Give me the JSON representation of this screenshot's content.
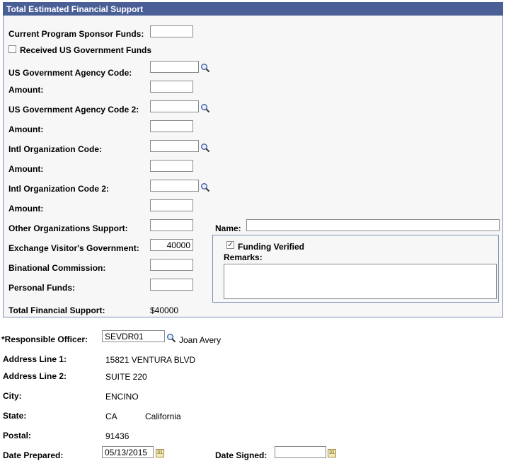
{
  "section_title": "Total Estimated Financial Support",
  "fields": {
    "current_program_sponsor_funds": {
      "label": "Current Program Sponsor Funds:",
      "value": ""
    },
    "received_us_gov_funds": {
      "label": "Received US Government Funds",
      "checked": false
    },
    "us_gov_agency_code": {
      "label": "US Government Agency Code:",
      "value": ""
    },
    "amount1": {
      "label": "Amount:",
      "value": ""
    },
    "us_gov_agency_code2": {
      "label": "US Government Agency Code 2:",
      "value": ""
    },
    "amount2": {
      "label": "Amount:",
      "value": ""
    },
    "intl_org_code": {
      "label": "Intl Organization Code:",
      "value": ""
    },
    "amount3": {
      "label": "Amount:",
      "value": ""
    },
    "intl_org_code2": {
      "label": "Intl Organization Code 2:",
      "value": ""
    },
    "amount4": {
      "label": "Amount:",
      "value": ""
    },
    "other_org_support": {
      "label": "Other Organizations Support:",
      "value": ""
    },
    "exchange_visitor_gov": {
      "label": "Exchange Visitor's Government:",
      "value": "40000"
    },
    "binational_commission": {
      "label": "Binational Commission:",
      "value": ""
    },
    "personal_funds": {
      "label": "Personal Funds:",
      "value": ""
    },
    "total_financial_support": {
      "label": "Total Financial Support:",
      "value": "$40000"
    },
    "name": {
      "label": "Name:",
      "value": ""
    },
    "funding_verified": {
      "label": "Funding Verified",
      "checked": true
    },
    "remarks": {
      "label": "Remarks:",
      "value": ""
    }
  },
  "officer": {
    "label": "*Responsible Officer:",
    "code": "SEVDR01",
    "name": "Joan Avery",
    "address1_label": "Address Line 1:",
    "address1": "15821 VENTURA BLVD",
    "address2_label": "Address Line 2:",
    "address2": "SUITE 220",
    "city_label": "City:",
    "city": "ENCINO",
    "state_label": "State:",
    "state_code": "CA",
    "state_name": "California",
    "postal_label": "Postal:",
    "postal": "91436",
    "date_prepared_label": "Date Prepared:",
    "date_prepared": "05/13/2015",
    "date_signed_label": "Date Signed:",
    "date_signed": ""
  },
  "icons": {
    "lookup": "magnifier-icon",
    "calendar": "calendar-icon",
    "calendar_glyph": "31"
  }
}
